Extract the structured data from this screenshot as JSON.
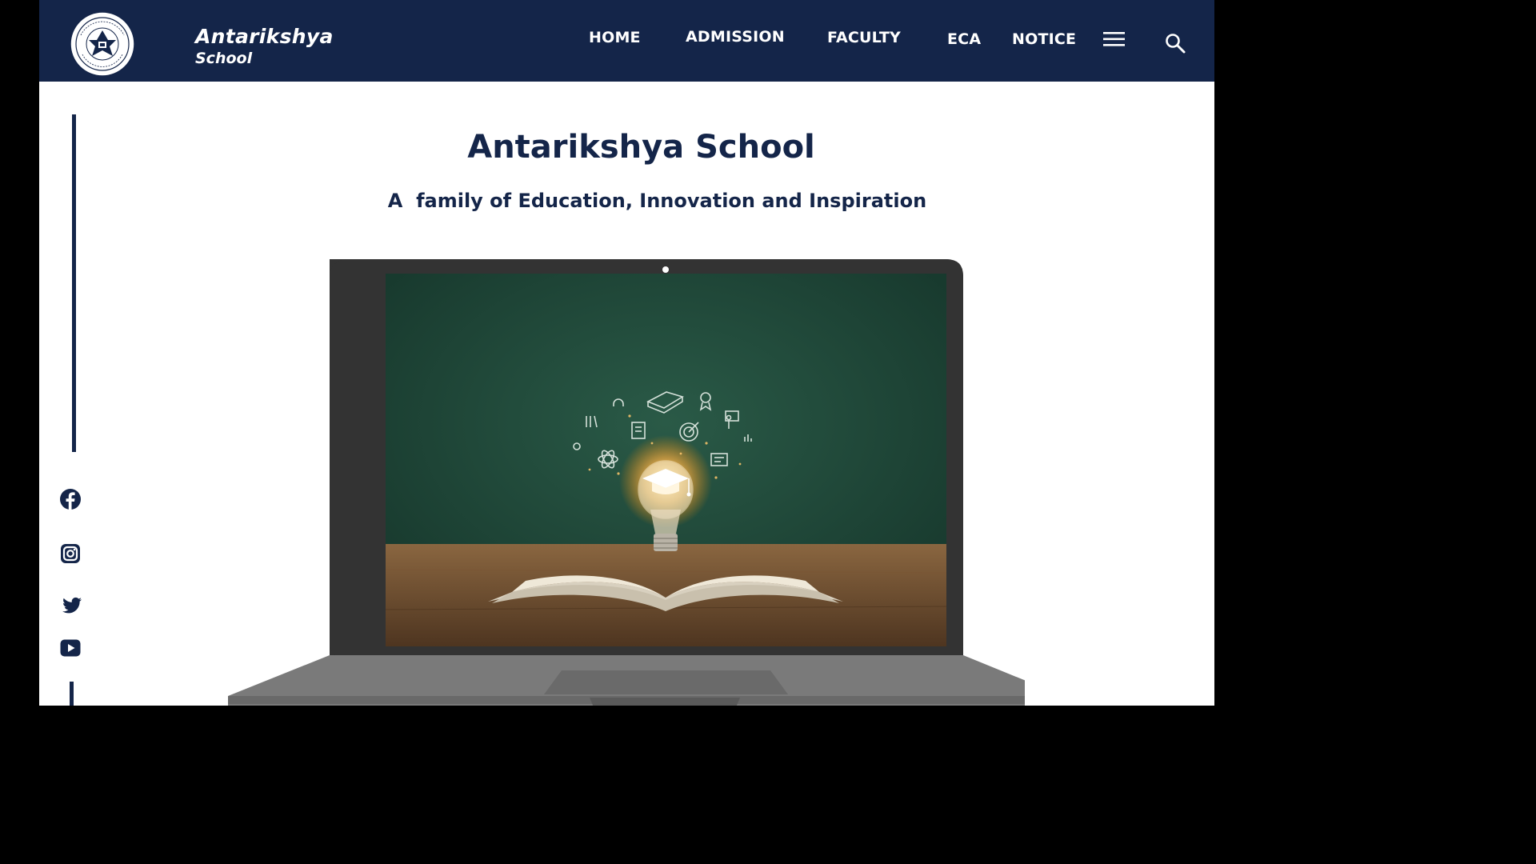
{
  "header": {
    "brand_name": "Antarikshya",
    "brand_sub": "School",
    "logo_icon": "school-emblem-icon",
    "nav": [
      {
        "label": "HOME"
      },
      {
        "label": "ADMISSION"
      },
      {
        "label": "FACULTY"
      },
      {
        "label": "ECA"
      },
      {
        "label": "NOTICE"
      }
    ],
    "menu_icon": "hamburger-menu-icon",
    "search_icon": "search-icon"
  },
  "hero": {
    "title": "Antarikshya School",
    "subtitle": "A  family of Education, Innovation and Inspiration",
    "image_description_icon": "lightbulb-graduation-cap-book-icon"
  },
  "social": [
    {
      "name": "facebook-icon"
    },
    {
      "name": "instagram-icon"
    },
    {
      "name": "twitter-icon"
    },
    {
      "name": "youtube-icon"
    }
  ],
  "colors": {
    "primary_navy": "#142549",
    "background": "#ffffff",
    "frame": "#000000",
    "laptop_bezel": "#333333",
    "laptop_base": "#7a7a7a",
    "screen_board": "#1f4638",
    "table_wood": "#6b4a2c"
  }
}
